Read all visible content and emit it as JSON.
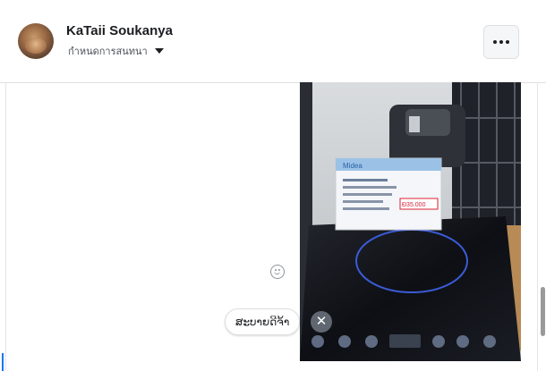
{
  "header": {
    "name": "KaTaii Soukanya",
    "subtitle": "กำหนดการสนทนา",
    "more_label": "···"
  },
  "photo": {
    "brand": "Midea",
    "price": "Đ35.000",
    "alt": "Induction cooker display"
  },
  "quick_reply": {
    "label": "ສະບາຍດີຈ້າ",
    "close": "✕"
  },
  "icons": {
    "avatar": "avatar",
    "caret": "chevron-down-icon",
    "more": "more-icon",
    "emoji": "smiley-icon",
    "close": "close-icon"
  }
}
